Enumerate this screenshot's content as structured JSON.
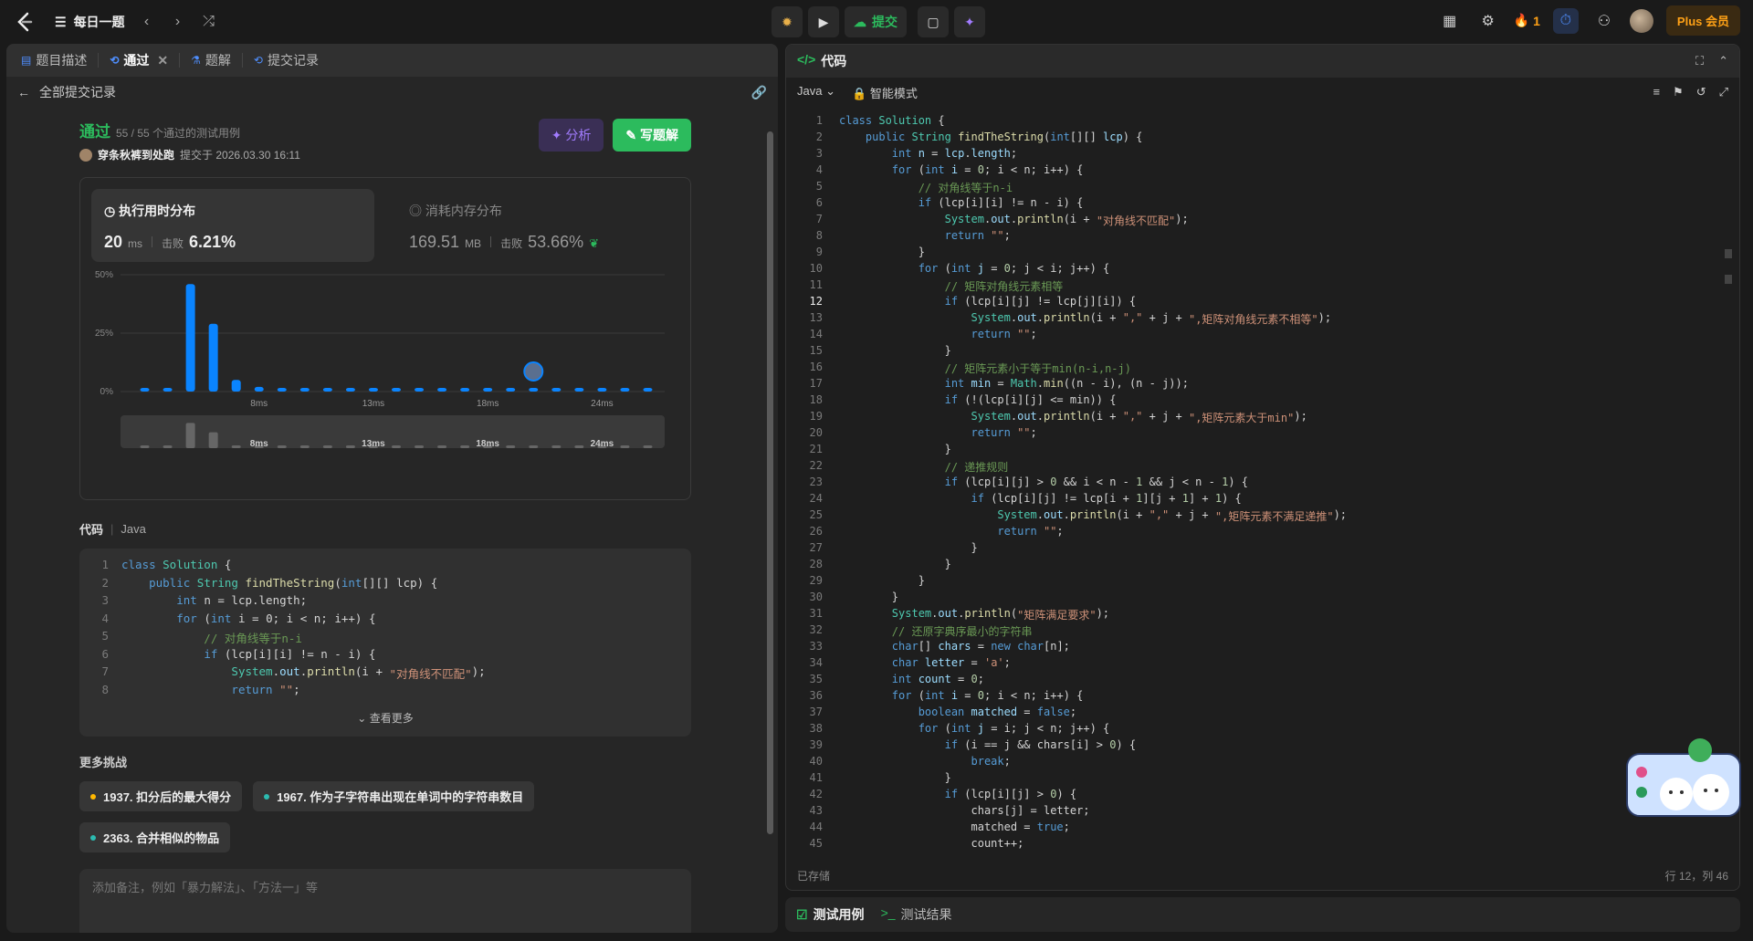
{
  "topbar": {
    "problem_list": "每日一题",
    "submit": "提交",
    "streak": "1",
    "plus": "Plus 会员"
  },
  "left": {
    "tabs": [
      {
        "label": "题目描述"
      },
      {
        "label": "通过"
      },
      {
        "label": "题解"
      },
      {
        "label": "提交记录"
      }
    ],
    "back": "全部提交记录",
    "status": "通过",
    "cases": "55 / 55 个通过的测试用例",
    "user": "穿条秋裤到处跑",
    "submitted": "提交于 2026.03.30 16:11",
    "analyze": "分析",
    "write": "写题解",
    "runtime": {
      "title": "执行用时分布",
      "value": "20",
      "unit": "ms",
      "beat_label": "击败",
      "beat": "6.21%"
    },
    "memory": {
      "title": "消耗内存分布",
      "value": "169.51",
      "unit": "MB",
      "beat_label": "击败",
      "beat": "53.66%"
    },
    "code_label": "代码",
    "lang": "Java",
    "see_more": "查看更多",
    "more_title": "更多挑战",
    "challenges": [
      {
        "label": "1937. 扣分后的最大得分",
        "color": "#ffb800"
      },
      {
        "label": "1967. 作为子字符串出现在单词中的字符串数目",
        "color": "#2cbbb0"
      },
      {
        "label": "2363. 合并相似的物品",
        "color": "#2cbbb0"
      }
    ],
    "note_placeholder": "添加备注，例如「暴力解法」、「方法一」等"
  },
  "chart_data": {
    "type": "bar",
    "title": "执行用时分布",
    "y_ticks": [
      "50%",
      "25%",
      "0%"
    ],
    "x_ticks": [
      "8ms",
      "13ms",
      "18ms",
      "24ms"
    ],
    "ylim": [
      0,
      50
    ],
    "values": [
      0.5,
      0.5,
      46,
      29,
      5,
      2,
      0.5,
      0.5,
      0.5,
      0.5,
      0.5,
      0.5,
      0.5,
      0.5,
      0.5,
      0.5,
      0.5,
      0.5,
      0.5,
      0.5,
      0.5,
      0.5,
      0.5
    ],
    "highlight_index": 17,
    "bar_color": "#0a84ff"
  },
  "right": {
    "title": "代码",
    "lang": "Java",
    "mode": "智能模式",
    "saved": "已存储",
    "cursor": "行 12，列 46",
    "tests": "测试用例",
    "results": "测试结果"
  }
}
